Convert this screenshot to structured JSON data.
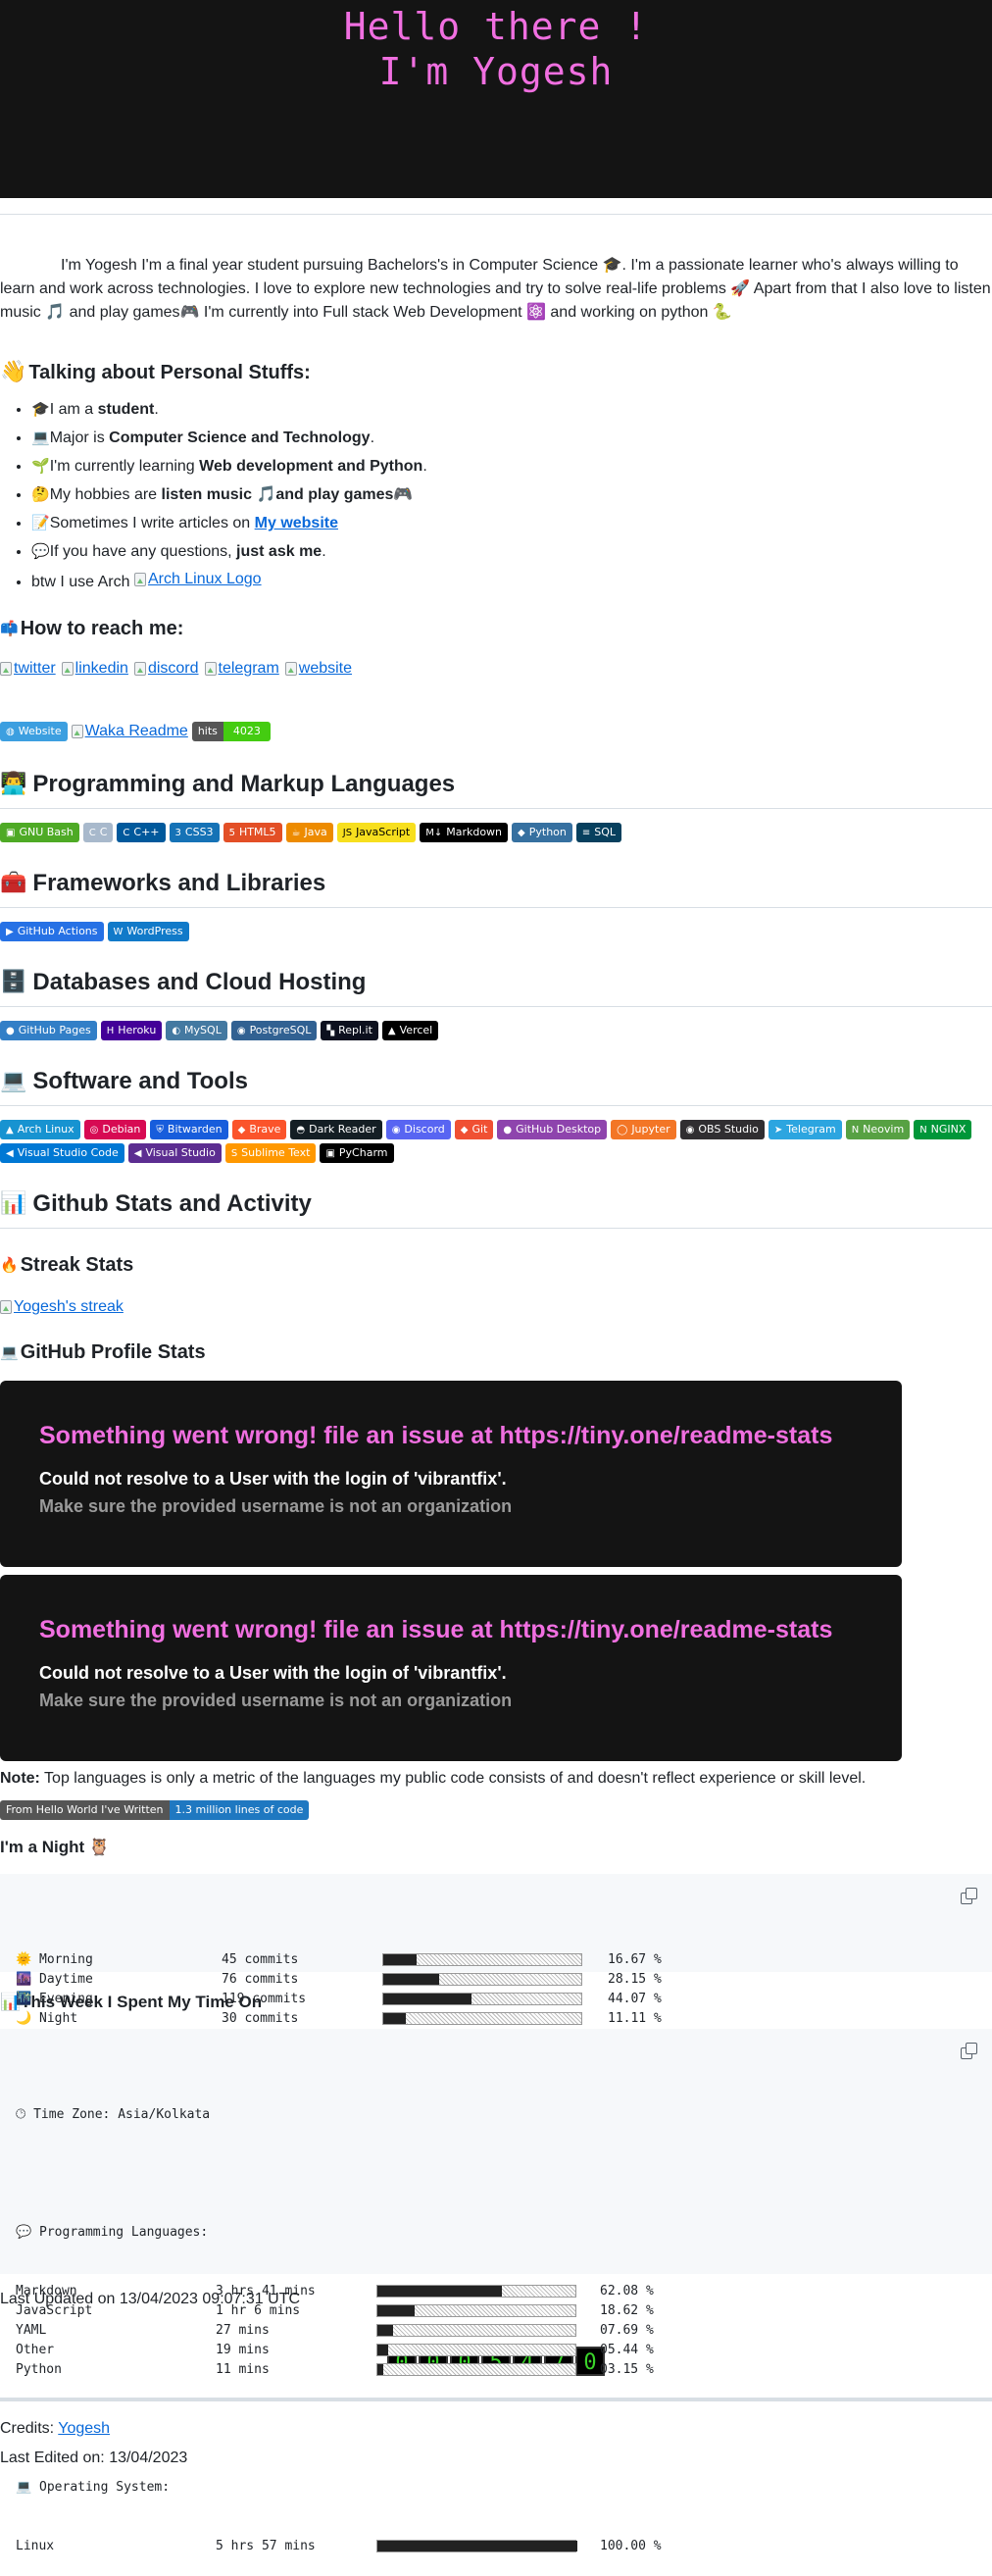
{
  "hero": {
    "line1": "Hello there !",
    "line2": "I'm Yogesh"
  },
  "intro": "I'm Yogesh I'm a final year student pursuing Bachelors's in Computer Science 🎓. I'm a passionate learner who's always willing to learn and work across technologies. I love to explore new technologies and try to solve real-life problems 🚀 Apart from that I also love to listen music 🎵 and play games🎮 I'm currently into Full stack Web Development ⚛️ and working on python 🐍",
  "personal": {
    "title": "Talking about Personal Stuffs:",
    "items": [
      {
        "icon": "🎓",
        "pre": "I am a ",
        "bold": "student",
        "post": "."
      },
      {
        "icon": "💻",
        "pre": "Major is ",
        "bold": "Computer Science and Technology",
        "post": "."
      },
      {
        "icon": "🌱",
        "pre": "I'm currently learning ",
        "bold": "Web development and Python",
        "post": "."
      },
      {
        "icon": "🤔",
        "pre": "My hobbies are ",
        "bold": "listen music 🎵and play games🎮",
        "post": ""
      },
      {
        "icon": "📝",
        "pre": "Sometimes I write articles on ",
        "link": "My website",
        "post": ""
      },
      {
        "icon": "💬",
        "pre": "If you have any questions, ",
        "bold": "just ask me",
        "post": "."
      }
    ],
    "arch_pre": "btw I use Arch ",
    "arch_link": "Arch Linux Logo"
  },
  "reach": {
    "title": "How to reach me:",
    "links": [
      "twitter",
      "linkedin",
      "discord",
      "telegram",
      "website"
    ]
  },
  "meta_badges": {
    "website": "Website",
    "waka": "Waka Readme",
    "hits_label": "hits",
    "hits_value": "4023"
  },
  "languages": {
    "title": "Programming and Markup Languages",
    "badges": [
      {
        "label": "GNU Bash",
        "color": "#4eaa25",
        "icon": "▣"
      },
      {
        "label": "C",
        "color": "#a8b9cc",
        "icon": "C"
      },
      {
        "label": "C++",
        "color": "#00599c",
        "icon": "C"
      },
      {
        "label": "CSS3",
        "color": "#1572b6",
        "icon": "3"
      },
      {
        "label": "HTML5",
        "color": "#e34f26",
        "icon": "5"
      },
      {
        "label": "Java",
        "color": "#ed8b00",
        "icon": "☕"
      },
      {
        "label": "JavaScript",
        "color": "#f7df1e",
        "icon": "JS",
        "dark": true
      },
      {
        "label": "Markdown",
        "color": "#000000",
        "icon": "M↓"
      },
      {
        "label": "Python",
        "color": "#3670a0",
        "icon": "◆"
      },
      {
        "label": "SQL",
        "color": "#07405e",
        "icon": "≡"
      }
    ]
  },
  "frameworks": {
    "title": "Frameworks and Libraries",
    "badges": [
      {
        "label": "GitHub Actions",
        "color": "#2671e5",
        "icon": "▶"
      },
      {
        "label": "WordPress",
        "color": "#117ac9",
        "icon": "W"
      }
    ]
  },
  "databases": {
    "title": "Databases and Cloud Hosting",
    "badges": [
      {
        "label": "GitHub Pages",
        "color": "#327fc7",
        "icon": "●"
      },
      {
        "label": "Heroku",
        "color": "#430098",
        "icon": "H"
      },
      {
        "label": "MySQL",
        "color": "#4479a1",
        "icon": "◐"
      },
      {
        "label": "PostgreSQL",
        "color": "#316192",
        "icon": "◉"
      },
      {
        "label": "Repl.it",
        "color": "#0d101e",
        "icon": "▚"
      },
      {
        "label": "Vercel",
        "color": "#000000",
        "icon": "▲"
      }
    ]
  },
  "software": {
    "title": "Software and Tools",
    "badges": [
      {
        "label": "Arch Linux",
        "color": "#1793d1",
        "icon": "▲"
      },
      {
        "label": "Debian",
        "color": "#d70a53",
        "icon": "◎"
      },
      {
        "label": "Bitwarden",
        "color": "#175ddc",
        "icon": "⛨"
      },
      {
        "label": "Brave",
        "color": "#fb542b",
        "icon": "◆"
      },
      {
        "label": "Dark Reader",
        "color": "#141e24",
        "icon": "◓"
      },
      {
        "label": "Discord",
        "color": "#5865f2",
        "icon": "◉"
      },
      {
        "label": "Git",
        "color": "#f05033",
        "icon": "◆"
      },
      {
        "label": "GitHub Desktop",
        "color": "#8e44ad",
        "icon": "●"
      },
      {
        "label": "Jupyter",
        "color": "#fa0f00",
        "icon": "◯",
        "alt_color": "#f37626"
      },
      {
        "label": "OBS Studio",
        "color": "#302e31",
        "icon": "◉"
      },
      {
        "label": "Telegram",
        "color": "#2ca5e0",
        "icon": "➤"
      },
      {
        "label": "Neovim",
        "color": "#57a143",
        "icon": "N"
      },
      {
        "label": "NGINX",
        "color": "#009639",
        "icon": "N"
      },
      {
        "label": "Visual Studio Code",
        "color": "#0078d4",
        "icon": "◀"
      },
      {
        "label": "Visual Studio",
        "color": "#5c2d91",
        "icon": "◀"
      },
      {
        "label": "Sublime Text",
        "color": "#ff9800",
        "icon": "S"
      },
      {
        "label": "PyCharm",
        "color": "#000000",
        "icon": "▣"
      }
    ]
  },
  "stats": {
    "title": "Github Stats and Activity",
    "streak_title": "Streak Stats",
    "streak_link": "Yogesh's streak",
    "profile_title": "GitHub Profile Stats",
    "cards": [
      {
        "error": "Something went wrong! file an issue at https://tiny.one/readme-stats",
        "detail": "Could not resolve to a User with the login of 'vibrantfix'.",
        "hint": "Make sure the provided username is not an organization"
      },
      {
        "error": "Something went wrong! file an issue at https://tiny.one/readme-stats",
        "detail": "Could not resolve to a User with the login of 'vibrantfix'.",
        "hint": "Make sure the provided username is not an organization"
      }
    ],
    "note_label": "Note:",
    "note_text": " Top languages is only a metric of the languages my public code consists of and doesn't reflect experience or skill level.",
    "loc_badge_left": "From Hello World I've Written",
    "loc_badge_right": "1.3 million lines of code"
  },
  "night": {
    "title": "I'm a Night 🦉",
    "rows": [
      {
        "label": "🌞 Morning",
        "commits": "45 commits",
        "pct": 16.67,
        "pct_text": "16.67 %"
      },
      {
        "label": "🌆 Daytime",
        "commits": "76 commits",
        "pct": 28.15,
        "pct_text": "28.15 %"
      },
      {
        "label": "🌃 Evening",
        "commits": "119 commits",
        "pct": 44.07,
        "pct_text": "44.07 %"
      },
      {
        "label": "🌙 Night",
        "commits": "30 commits",
        "pct": 11.11,
        "pct_text": "11.11 %"
      }
    ]
  },
  "week": {
    "title": "📊This Week I Spent My Time On",
    "timezone": "🕑︎ Time Zone: Asia/Kolkata",
    "lang_header": "💬 Programming Languages:",
    "langs": [
      {
        "name": "Markdown",
        "time": "3 hrs 41 mins",
        "pct": 62.08,
        "pct_text": "62.08 %"
      },
      {
        "name": "JavaScript",
        "time": "1 hr 6 mins",
        "pct": 18.62,
        "pct_text": "18.62 %"
      },
      {
        "name": "YAML",
        "time": "27 mins",
        "pct": 7.69,
        "pct_text": "07.69 %"
      },
      {
        "name": "Other",
        "time": "19 mins",
        "pct": 5.44,
        "pct_text": "05.44 %"
      },
      {
        "name": "Python",
        "time": "11 mins",
        "pct": 3.15,
        "pct_text": "03.15 %"
      }
    ],
    "os_header": "💻 Operating System:",
    "os": [
      {
        "name": "Linux",
        "time": "5 hrs 57 mins",
        "pct": 100,
        "pct_text": "100.00 %"
      }
    ]
  },
  "last_updated": "Last Updated on 13/04/2023 09:07:31 UTC",
  "counter_digits": [
    "0",
    "0",
    "0",
    "5",
    "4",
    "7",
    "0"
  ],
  "credits_label": "Credits: ",
  "credits_link": "Yogesh",
  "last_edited": "Last Edited on: 13/04/2023"
}
